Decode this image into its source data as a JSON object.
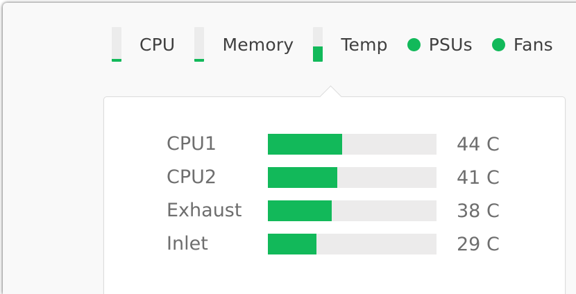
{
  "accent_color": "#12b95a",
  "status_bar": {
    "items": [
      {
        "label": "CPU",
        "indicator": "meter",
        "level": 0.08
      },
      {
        "label": "Memory",
        "indicator": "meter",
        "level": 0.08
      },
      {
        "label": "Temp",
        "indicator": "meter",
        "level": 0.45
      },
      {
        "label": "PSUs",
        "indicator": "status-dot",
        "status": "ok"
      },
      {
        "label": "Fans",
        "indicator": "status-dot",
        "status": "ok"
      }
    ]
  },
  "temperature_popover": {
    "rows": [
      {
        "name": "CPU1",
        "value": "44 C",
        "level": 0.44
      },
      {
        "name": "CPU2",
        "value": "41 C",
        "level": 0.41
      },
      {
        "name": "Exhaust",
        "value": "38 C",
        "level": 0.38
      },
      {
        "name": "Inlet",
        "value": "29 C",
        "level": 0.29
      }
    ]
  }
}
